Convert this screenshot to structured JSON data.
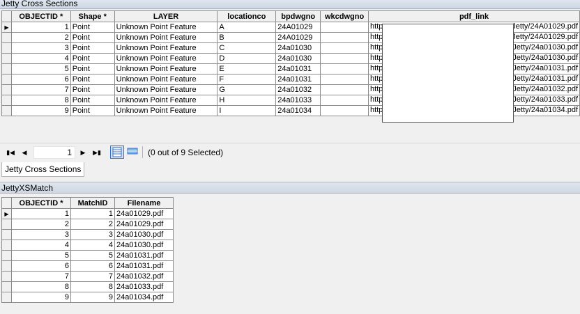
{
  "table1": {
    "title": "Jetty Cross Sections",
    "columns": [
      "OBJECTID *",
      "Shape *",
      "LAYER",
      "locationco",
      "bpdwgno",
      "wkcdwgno",
      "pdf_link"
    ],
    "rows": [
      {
        "objectid": "1",
        "shape": "Point",
        "layer": "Unknown Point Feature",
        "location": "A",
        "bpdwgno": "24A01029",
        "wkcdwgno": "",
        "pdf_prefix": "http",
        "pdf_suffix": "Jetty/24A01029.pdf"
      },
      {
        "objectid": "2",
        "shape": "Point",
        "layer": "Unknown Point Feature",
        "location": "B",
        "bpdwgno": "24A01029",
        "wkcdwgno": "",
        "pdf_prefix": "http",
        "pdf_suffix": "Jetty/24A01029.pdf"
      },
      {
        "objectid": "3",
        "shape": "Point",
        "layer": "Unknown Point Feature",
        "location": "C",
        "bpdwgno": "24a01030",
        "wkcdwgno": "",
        "pdf_prefix": "http",
        "pdf_suffix": "Jetty/24a01030.pdf"
      },
      {
        "objectid": "4",
        "shape": "Point",
        "layer": "Unknown Point Feature",
        "location": "D",
        "bpdwgno": "24a01030",
        "wkcdwgno": "",
        "pdf_prefix": "http",
        "pdf_suffix": "Jetty/24a01030.pdf"
      },
      {
        "objectid": "5",
        "shape": "Point",
        "layer": "Unknown Point Feature",
        "location": "E",
        "bpdwgno": "24a01031",
        "wkcdwgno": "",
        "pdf_prefix": "http",
        "pdf_suffix": "Jetty/24a01031.pdf"
      },
      {
        "objectid": "6",
        "shape": "Point",
        "layer": "Unknown Point Feature",
        "location": "F",
        "bpdwgno": "24a01031",
        "wkcdwgno": "",
        "pdf_prefix": "http",
        "pdf_suffix": "Jetty/24a01031.pdf"
      },
      {
        "objectid": "7",
        "shape": "Point",
        "layer": "Unknown Point Feature",
        "location": "G",
        "bpdwgno": "24a01032",
        "wkcdwgno": "",
        "pdf_prefix": "http",
        "pdf_suffix": "Jetty/24a01032.pdf"
      },
      {
        "objectid": "8",
        "shape": "Point",
        "layer": "Unknown Point Feature",
        "location": "H",
        "bpdwgno": "24a01033",
        "wkcdwgno": "",
        "pdf_prefix": "http",
        "pdf_suffix": "Jetty/24a01033.pdf"
      },
      {
        "objectid": "9",
        "shape": "Point",
        "layer": "Unknown Point Feature",
        "location": "I",
        "bpdwgno": "24a01034",
        "wkcdwgno": "",
        "pdf_prefix": "http",
        "pdf_suffix": "Jetty/24a01034.pdf"
      }
    ]
  },
  "navigation": {
    "current_record": "1",
    "selection_status": "(0 out of 9 Selected)",
    "icons": [
      "first-record-icon",
      "previous-record-icon",
      "next-record-icon",
      "last-record-icon",
      "show-all-records-icon",
      "show-selected-records-icon"
    ]
  },
  "tabs": [
    "Jetty Cross Sections"
  ],
  "table2": {
    "title": "JettyXSMatch",
    "columns": [
      "OBJECTID *",
      "MatchID",
      "Filename"
    ],
    "rows": [
      {
        "objectid": "1",
        "matchid": "1",
        "filename": "24a01029.pdf"
      },
      {
        "objectid": "2",
        "matchid": "2",
        "filename": "24a01029.pdf"
      },
      {
        "objectid": "3",
        "matchid": "3",
        "filename": "24a01030.pdf"
      },
      {
        "objectid": "4",
        "matchid": "4",
        "filename": "24a01030.pdf"
      },
      {
        "objectid": "5",
        "matchid": "5",
        "filename": "24a01031.pdf"
      },
      {
        "objectid": "6",
        "matchid": "6",
        "filename": "24a01031.pdf"
      },
      {
        "objectid": "7",
        "matchid": "7",
        "filename": "24a01032.pdf"
      },
      {
        "objectid": "8",
        "matchid": "8",
        "filename": "24a01033.pdf"
      },
      {
        "objectid": "9",
        "matchid": "9",
        "filename": "24a01034.pdf"
      }
    ]
  },
  "colors": {
    "selected_view_button": "#3a6fc4",
    "title_bar": "#d4dce8"
  }
}
